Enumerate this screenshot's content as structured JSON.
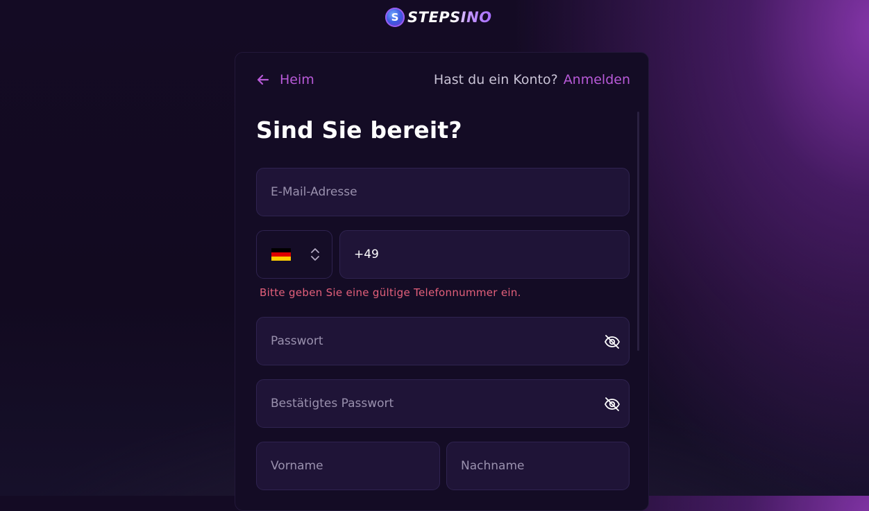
{
  "brand": {
    "name": "STEPSINO",
    "coin_letter": "S"
  },
  "nav": {
    "back_label": "Heim",
    "account_question": "Hast du ein Konto?",
    "login_label": "Anmelden"
  },
  "form": {
    "title": "Sind Sie bereit?",
    "email": {
      "placeholder": "E-Mail-Adresse",
      "value": ""
    },
    "phone": {
      "country": "Deutschland",
      "country_code": "+49",
      "value": ""
    },
    "phone_error": "Bitte geben Sie eine gültige Telefonnummer ein.",
    "password": {
      "placeholder": "Passwort",
      "value": ""
    },
    "confirm_password": {
      "placeholder": "Bestätigtes Passwort",
      "value": ""
    },
    "first_name": {
      "placeholder": "Vorname",
      "value": ""
    },
    "last_name": {
      "placeholder": "Nachname",
      "value": ""
    }
  },
  "colors": {
    "accent": "#b85ad8",
    "error": "#e4607b",
    "card_bg": "#140c25",
    "field_bg": "#1f1437"
  },
  "icons": [
    "arrow-left-icon",
    "chevron-up-down-icon",
    "eye-off-icon",
    "germany-flag"
  ]
}
